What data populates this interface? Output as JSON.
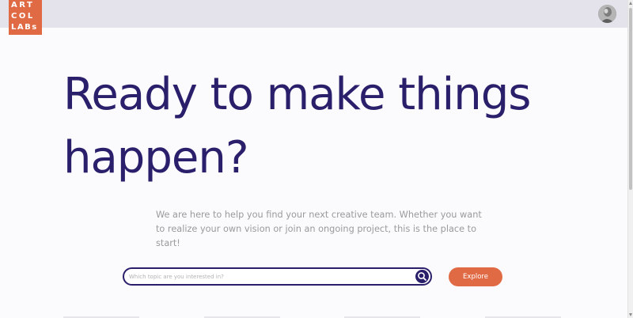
{
  "logo": {
    "line1": "ART",
    "line2": "COL",
    "line3": "LABs"
  },
  "header": {
    "avatar_icon": "user-avatar"
  },
  "hero": {
    "title": "Ready to make things happen?",
    "subtitle": "We are here to help you find your next creative team. Whether you want to realize your own vision or join an ongoing project, this is the place to start!"
  },
  "search": {
    "placeholder": "Which topic are you interested in?",
    "value": "",
    "icon": "search-icon"
  },
  "actions": {
    "explore_label": "Explore"
  },
  "colors": {
    "primary": "#2a1f6b",
    "accent": "#e06a44",
    "header_bg": "#e4e3ec",
    "muted_text": "#9a9a9a"
  }
}
